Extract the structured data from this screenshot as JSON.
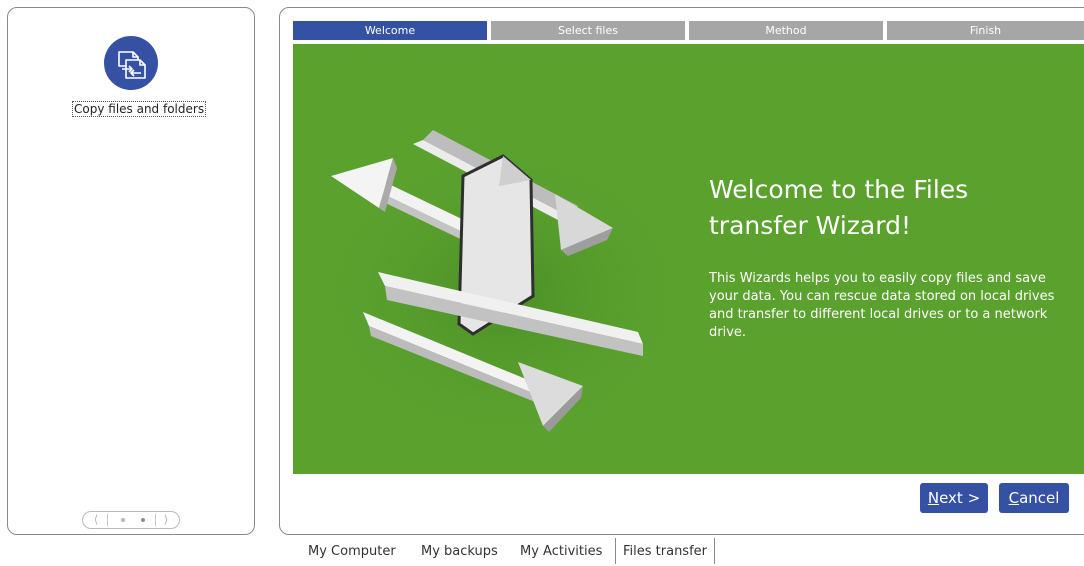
{
  "sidebar": {
    "action": {
      "icon": "copy-files-icon",
      "label": "Copy files and folders"
    },
    "pager": {
      "prev_icon": "chevron-left-icon",
      "next_icon": "chevron-right-icon",
      "prev_glyph": "⟨",
      "next_glyph": "⟩",
      "page_count": 2,
      "active_page": 2
    }
  },
  "wizard": {
    "steps": [
      {
        "label": "Welcome",
        "active": true
      },
      {
        "label": "Select files",
        "active": false
      },
      {
        "label": "Method",
        "active": false
      },
      {
        "label": "Finish",
        "active": false
      }
    ],
    "title": "Welcome to the Files transfer Wizard!",
    "description": "This Wizards helps you to easily copy files and save your data. You can rescue data stored on local drives and transfer to different local drives or to a network drive.",
    "illustration": "file-transfer-arrows-illustration",
    "buttons": {
      "next_mnemonic": "N",
      "next_rest": "ext >",
      "cancel_mnemonic": "C",
      "cancel_rest": "ancel"
    }
  },
  "bottom_tabs": [
    {
      "label": "My Computer",
      "active": false
    },
    {
      "label": "My backups",
      "active": false
    },
    {
      "label": "My Activities",
      "active": false
    },
    {
      "label": "Files transfer",
      "active": true
    }
  ],
  "colors": {
    "accent": "#3551a4",
    "hero_background": "#5aa12e",
    "inactive_step": "#a6a6a6",
    "text_on_accent": "#ffffff"
  }
}
